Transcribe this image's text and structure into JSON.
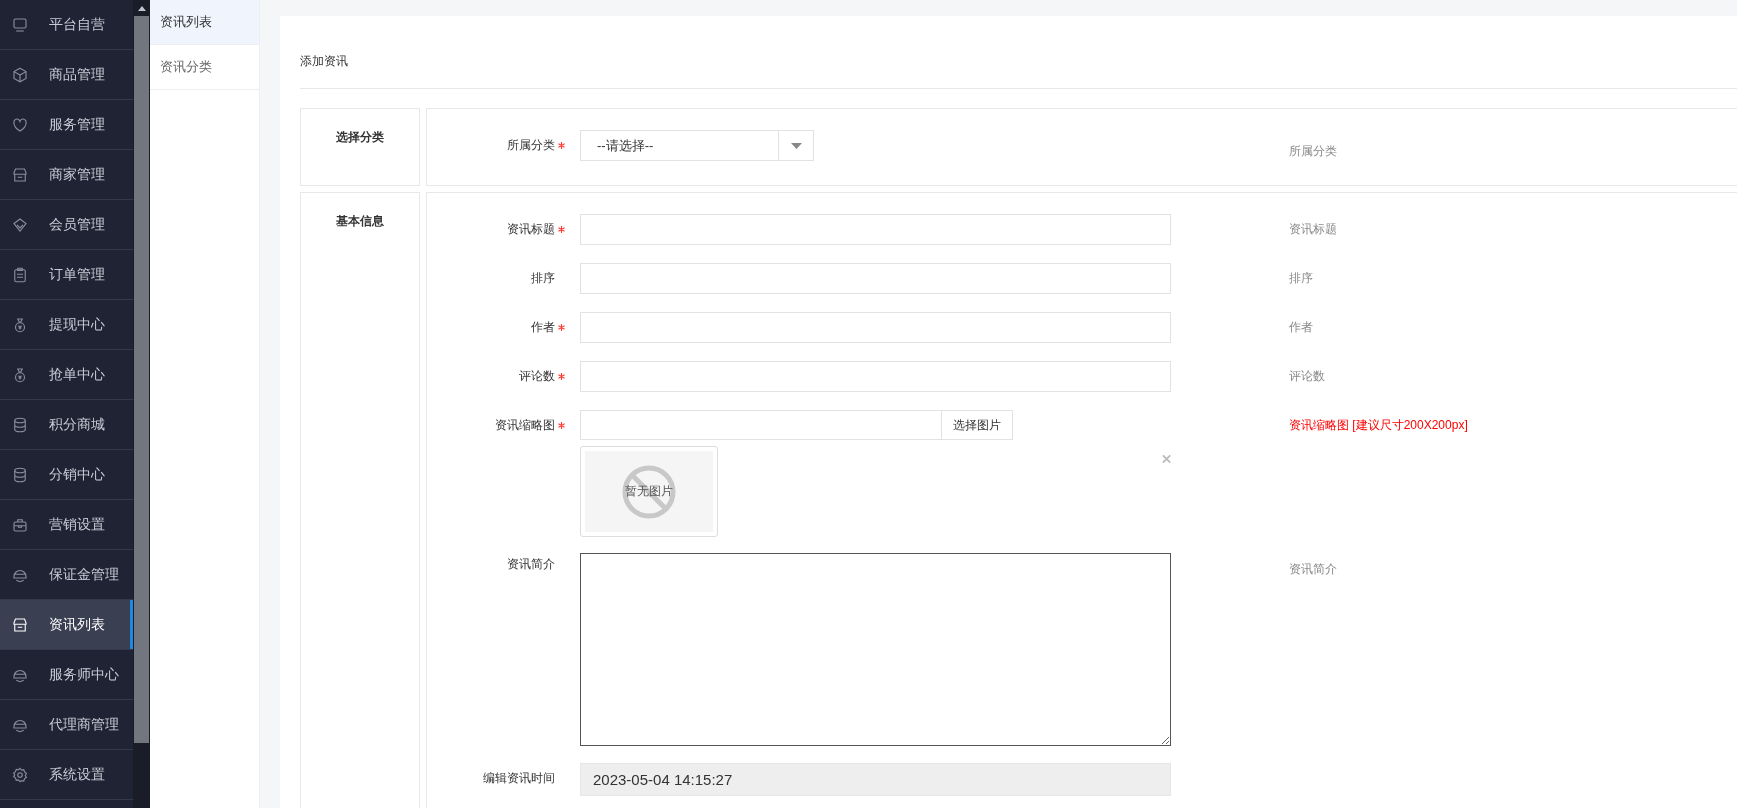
{
  "sidebar": {
    "items": [
      {
        "label": "平台自营",
        "selected": false
      },
      {
        "label": "商品管理",
        "selected": false
      },
      {
        "label": "服务管理",
        "selected": false
      },
      {
        "label": "商家管理",
        "selected": false
      },
      {
        "label": "会员管理",
        "selected": false
      },
      {
        "label": "订单管理",
        "selected": false
      },
      {
        "label": "提现中心",
        "selected": false
      },
      {
        "label": "抢单中心",
        "selected": false
      },
      {
        "label": "积分商城",
        "selected": false
      },
      {
        "label": "分销中心",
        "selected": false
      },
      {
        "label": "营销设置",
        "selected": false
      },
      {
        "label": "保证金管理",
        "selected": false
      },
      {
        "label": "资讯列表",
        "selected": true
      },
      {
        "label": "服务师中心",
        "selected": false
      },
      {
        "label": "代理商管理",
        "selected": false
      },
      {
        "label": "系统设置",
        "selected": false
      }
    ]
  },
  "subnav": {
    "items": [
      {
        "label": "资讯列表",
        "selected": true
      },
      {
        "label": "资讯分类",
        "selected": false
      }
    ]
  },
  "page_title": "添加资讯",
  "sections": [
    {
      "title": "选择分类",
      "fields": [
        {
          "kind": "select",
          "label": "所属分类",
          "required": true,
          "value": "--请选择--",
          "hint": "所属分类",
          "hint_warning": false
        }
      ]
    },
    {
      "title": "基本信息",
      "fields": [
        {
          "kind": "text",
          "label": "资讯标题",
          "required": true,
          "hint": "资讯标题",
          "hint_warning": false
        },
        {
          "kind": "text",
          "label": "排序",
          "required": false,
          "hint": "排序",
          "hint_warning": false
        },
        {
          "kind": "text",
          "label": "作者",
          "required": true,
          "hint": "作者",
          "hint_warning": false
        },
        {
          "kind": "text",
          "label": "评论数",
          "required": true,
          "hint": "评论数",
          "hint_warning": false
        },
        {
          "kind": "image",
          "label": "资讯缩略图",
          "required": true,
          "button": "选择图片",
          "preview_text": "暂无图片",
          "hint": "资讯缩略图 [建议尺寸200X200px]",
          "hint_warning": true
        },
        {
          "kind": "textarea",
          "label": "资讯简介",
          "required": false,
          "hint": "资讯简介",
          "hint_warning": false
        },
        {
          "kind": "text",
          "label": "编辑资讯时间",
          "required": false,
          "value": "2023-05-04 14:15:27",
          "disabled": true
        }
      ]
    }
  ]
}
